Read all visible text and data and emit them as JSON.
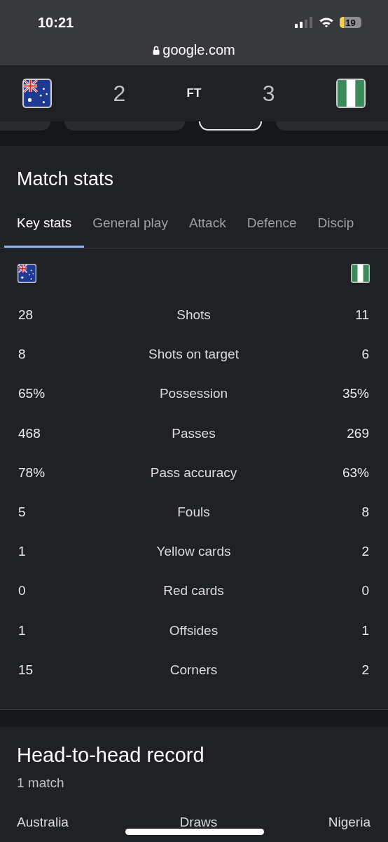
{
  "status_bar": {
    "time": "10:21",
    "battery": "19"
  },
  "address_bar": {
    "url": "google.com"
  },
  "scoreboard": {
    "home_score": "2",
    "status": "FT",
    "away_score": "3"
  },
  "match_stats": {
    "title": "Match stats",
    "tabs": [
      {
        "label": "Key stats",
        "selected": true
      },
      {
        "label": "General play",
        "selected": false
      },
      {
        "label": "Attack",
        "selected": false
      },
      {
        "label": "Defence",
        "selected": false
      },
      {
        "label": "Discip",
        "selected": false
      }
    ],
    "rows": [
      {
        "home": "28",
        "label": "Shots",
        "away": "11"
      },
      {
        "home": "8",
        "label": "Shots on target",
        "away": "6"
      },
      {
        "home": "65%",
        "label": "Possession",
        "away": "35%"
      },
      {
        "home": "468",
        "label": "Passes",
        "away": "269"
      },
      {
        "home": "78%",
        "label": "Pass accuracy",
        "away": "63%"
      },
      {
        "home": "5",
        "label": "Fouls",
        "away": "8"
      },
      {
        "home": "1",
        "label": "Yellow cards",
        "away": "2"
      },
      {
        "home": "0",
        "label": "Red cards",
        "away": "0"
      },
      {
        "home": "1",
        "label": "Offsides",
        "away": "1"
      },
      {
        "home": "15",
        "label": "Corners",
        "away": "2"
      }
    ]
  },
  "head_to_head": {
    "title": "Head-to-head record",
    "subtitle": "1 match",
    "columns": [
      "Australia",
      "Draws",
      "Nigeria"
    ]
  }
}
